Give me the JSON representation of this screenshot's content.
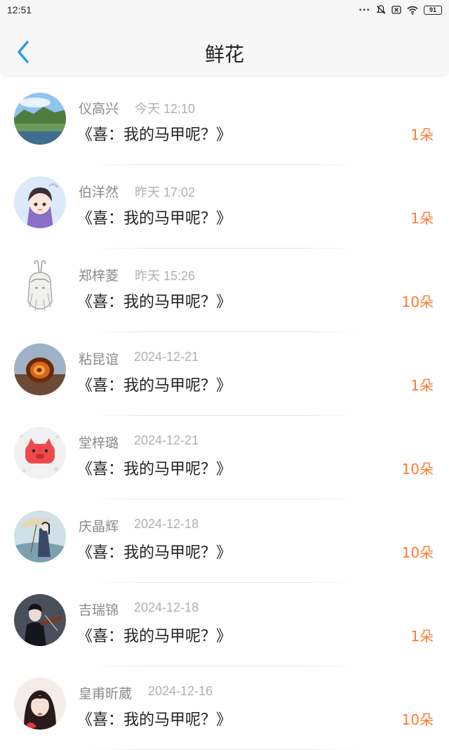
{
  "status_bar": {
    "time": "12:51",
    "battery": "91"
  },
  "header": {
    "title": "鲜花"
  },
  "colors": {
    "accent": "#2f9bf0",
    "count": "#ff7a2e"
  },
  "list": [
    {
      "name": "仪高兴",
      "time": "今天 12:10",
      "gift": "《喜：我的马甲呢？》",
      "count": "1朵"
    },
    {
      "name": "伯洋然",
      "time": "昨天 17:02",
      "gift": "《喜：我的马甲呢？》",
      "count": "1朵"
    },
    {
      "name": "郑梓菱",
      "time": "昨天 15:26",
      "gift": "《喜：我的马甲呢？》",
      "count": "10朵"
    },
    {
      "name": "粘昆谊",
      "time": "2024-12-21",
      "gift": "《喜：我的马甲呢？》",
      "count": "1朵"
    },
    {
      "name": "堂梓璐",
      "time": "2024-12-21",
      "gift": "《喜：我的马甲呢？》",
      "count": "10朵"
    },
    {
      "name": "庆晶辉",
      "time": "2024-12-18",
      "gift": "《喜：我的马甲呢？》",
      "count": "10朵"
    },
    {
      "name": "吉瑞锦",
      "time": "2024-12-18",
      "gift": "《喜：我的马甲呢？》",
      "count": "1朵"
    },
    {
      "name": "皇甫昕葳",
      "time": "2024-12-16",
      "gift": "《喜：我的马甲呢？》",
      "count": "10朵"
    }
  ]
}
